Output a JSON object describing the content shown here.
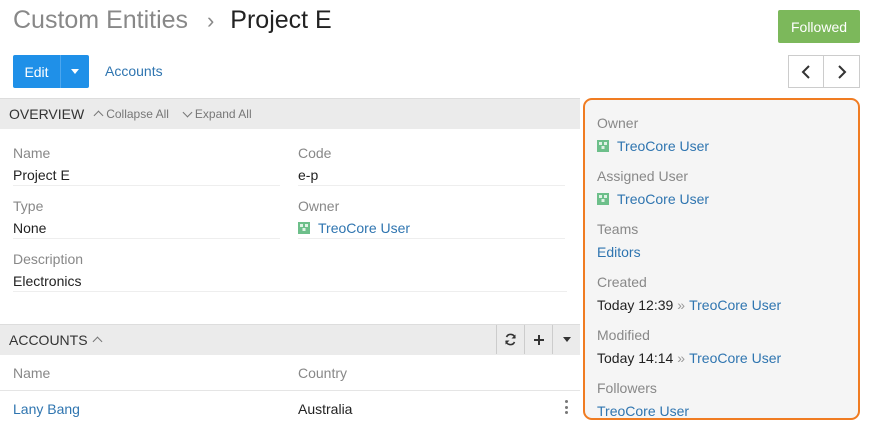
{
  "breadcrumb": {
    "parent": "Custom Entities",
    "separator": "›",
    "current": "Project E"
  },
  "header": {
    "follow_label": "Followed",
    "follow_color": "#7cb85b"
  },
  "toolbar": {
    "edit_label": "Edit",
    "accounts_link": "Accounts"
  },
  "overview": {
    "title": "OVERVIEW",
    "collapse_all": "Collapse All",
    "expand_all": "Expand All",
    "fields": {
      "name": {
        "label": "Name",
        "value": "Project E"
      },
      "code": {
        "label": "Code",
        "value": "e-p"
      },
      "type": {
        "label": "Type",
        "value": "None"
      },
      "owner": {
        "label": "Owner",
        "value": "TreoCore User"
      },
      "description": {
        "label": "Description",
        "value": "Electronics"
      }
    }
  },
  "accounts": {
    "title": "ACCOUNTS",
    "columns": [
      "Name",
      "Country"
    ],
    "rows": [
      {
        "name": "Lany Bang",
        "country": "Australia"
      }
    ]
  },
  "side": {
    "owner": {
      "label": "Owner",
      "value": "TreoCore User"
    },
    "assigned_user": {
      "label": "Assigned User",
      "value": "TreoCore User"
    },
    "teams": {
      "label": "Teams",
      "value": "Editors"
    },
    "created": {
      "label": "Created",
      "time": "Today 12:39",
      "separator": "»",
      "user": "TreoCore User"
    },
    "modified": {
      "label": "Modified",
      "time": "Today 14:14",
      "separator": "»",
      "user": "TreoCore User"
    },
    "followers": {
      "label": "Followers",
      "value": "TreoCore User"
    }
  },
  "colors": {
    "primary": "#1f90e8",
    "link": "#2f75b0",
    "highlight": "#f07c22"
  },
  "icons": [
    "chevron-left-icon",
    "chevron-right-icon",
    "refresh-icon",
    "plus-icon",
    "kebab-menu-icon",
    "user-avatar-icon"
  ]
}
